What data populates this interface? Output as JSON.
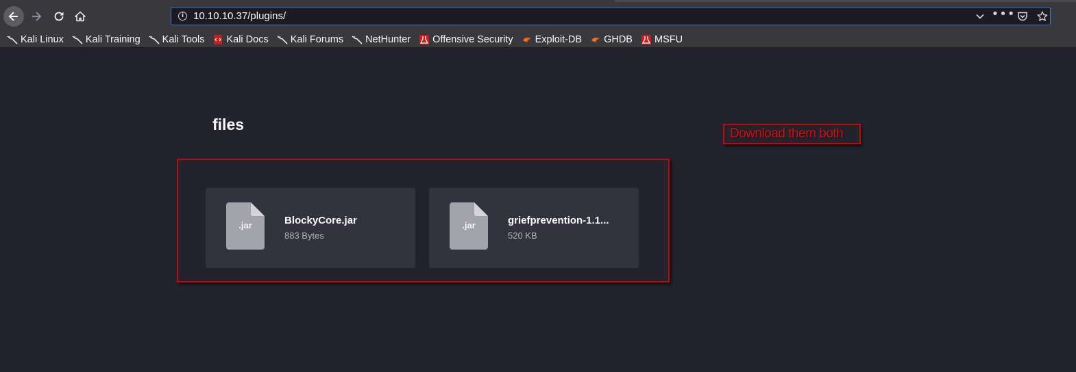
{
  "browser": {
    "url": "10.10.10.37/plugins/",
    "icons": {
      "back": "back-arrow-icon",
      "forward": "forward-arrow-icon",
      "reload": "reload-icon",
      "home": "home-icon",
      "info": "info-icon",
      "dropdown": "chevron-down-icon",
      "more": "more-horizontal-icon",
      "pocket": "pocket-icon",
      "bookmark_star": "star-icon"
    }
  },
  "bookmarks": [
    {
      "label": "Kali Linux",
      "icon": "kali-dragon-icon"
    },
    {
      "label": "Kali Training",
      "icon": "kali-dragon-icon"
    },
    {
      "label": "Kali Tools",
      "icon": "kali-dragon-icon"
    },
    {
      "label": "Kali Docs",
      "icon": "kali-docs-icon"
    },
    {
      "label": "Kali Forums",
      "icon": "kali-dragon-icon"
    },
    {
      "label": "NetHunter",
      "icon": "kali-dragon-icon"
    },
    {
      "label": "Offensive Security",
      "icon": "offsec-icon"
    },
    {
      "label": "Exploit-DB",
      "icon": "exploit-db-icon"
    },
    {
      "label": "GHDB",
      "icon": "exploit-db-icon"
    },
    {
      "label": "MSFU",
      "icon": "offsec-icon"
    }
  ],
  "page": {
    "heading": "files",
    "files": [
      {
        "ext": ".jar",
        "name": "BlockyCore.jar",
        "size": "883 Bytes",
        "icon": "file-icon"
      },
      {
        "ext": ".jar",
        "name": "griefprevention-1.1...",
        "size": "520 KB",
        "icon": "file-icon"
      }
    ]
  },
  "annotation": {
    "text": "Download them both",
    "color": "#c00a0a"
  },
  "colors": {
    "page_background": "#23232e",
    "card_background": "#33333f",
    "toolbar": "#38383d",
    "highlight": "#c00a0a"
  }
}
